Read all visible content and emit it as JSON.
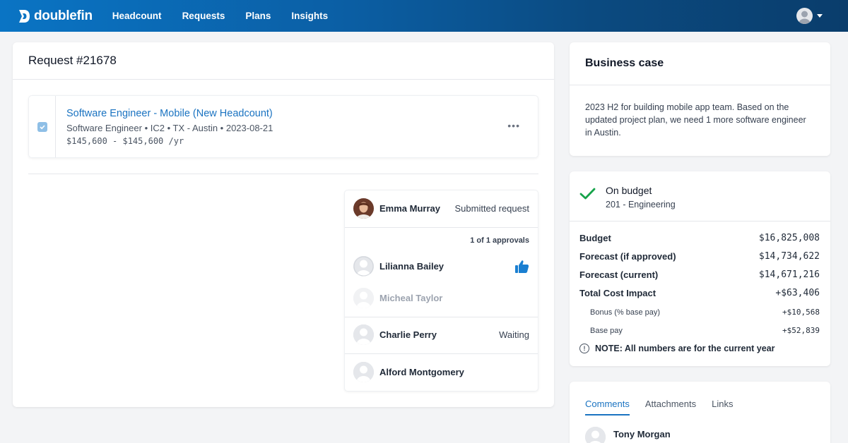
{
  "nav": {
    "brand": "doublefin",
    "links": [
      "Headcount",
      "Requests",
      "Plans",
      "Insights"
    ]
  },
  "request": {
    "title": "Request #21678",
    "position": {
      "title": "Software Engineer - Mobile (New Headcount)",
      "meta": "Software Engineer • IC2 • TX - Austin • 2023-08-21",
      "salary": "$145,600 - $145,600 /yr",
      "checked": true
    }
  },
  "approvals": {
    "submitter": {
      "name": "Emma Murray",
      "status": "Submitted request"
    },
    "count_label": "1 of 1 approvals",
    "approvers": [
      {
        "name": "Lilianna Bailey",
        "icon": "thumbs-up-icon"
      },
      {
        "name": "Micheal Taylor"
      }
    ],
    "waiting": {
      "name": "Charlie Perry",
      "status": "Waiting"
    },
    "next": {
      "name": "Alford Montgomery"
    }
  },
  "business_case": {
    "title": "Business case",
    "text": "2023 H2 for building mobile app team. Based on the updated project plan, we need 1 more software engineer in Austin."
  },
  "budget": {
    "status": "On budget",
    "department": "201 - Engineering",
    "rows": [
      {
        "label": "Budget",
        "value": "$16,825,008"
      },
      {
        "label": "Forecast (if approved)",
        "value": "$14,734,622"
      },
      {
        "label": "Forecast (current)",
        "value": "$14,671,216"
      },
      {
        "label": "Total Cost Impact",
        "value": "+$63,406"
      },
      {
        "label": "Bonus (% base pay)",
        "value": "+$10,568"
      },
      {
        "label": "Base pay",
        "value": "+$52,839"
      }
    ],
    "note": "NOTE: All numbers are for the current year",
    "accent": "#16a34a"
  },
  "comments": {
    "tabs": [
      "Comments",
      "Attachments",
      "Links"
    ],
    "active_tab": "Comments",
    "first_author": "Tony Morgan"
  },
  "colors": {
    "brand": "#0a74c4",
    "link": "#1a73c1"
  }
}
